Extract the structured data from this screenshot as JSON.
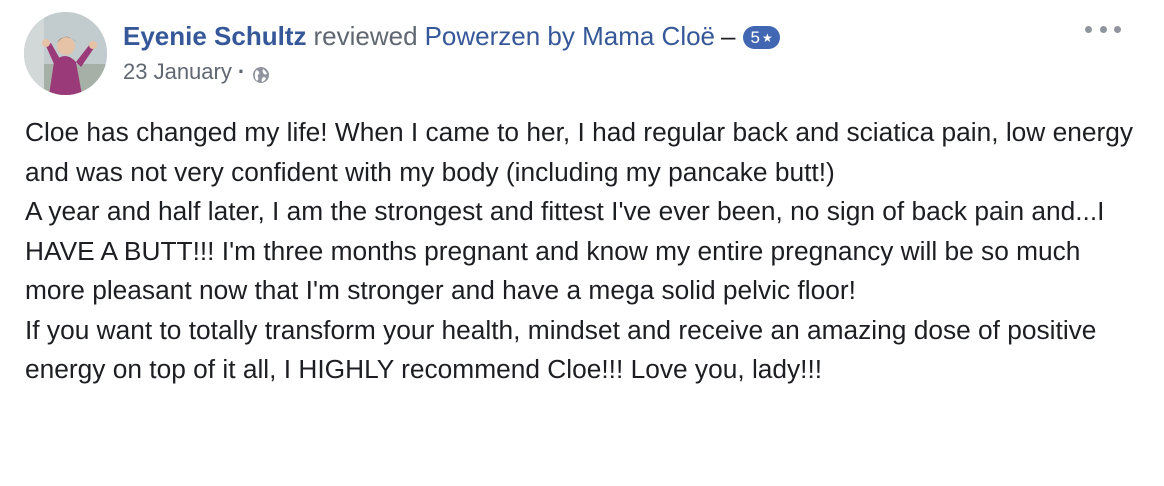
{
  "post": {
    "author": "Eyenie Schultz",
    "action": "reviewed",
    "page_name": "Powerzen by Mama Cloë",
    "separator": "–",
    "rating": {
      "value": "5",
      "icon": "star-icon",
      "glyph": "★"
    },
    "date": "23 January",
    "dot": "·",
    "privacy_icon": "globe-icon",
    "options_icon": "more-options-icon",
    "body": [
      "Cloe has changed my life! When I came to her, I had regular back and sciatica pain, low energy and was not very confident with my body (including my pancake butt!)",
      "A year and half later, I am the strongest and fittest I've ever been, no sign of back pain and...I HAVE A BUTT!!! I'm three months pregnant and know my entire pregnancy will be so much more pleasant now that I'm stronger and have a mega solid pelvic floor!",
      "If you want to totally transform your health, mindset and receive an amazing dose of positive energy on top of it all, I HIGHLY recommend Cloe!!! Love you, lady!!!"
    ]
  },
  "colors": {
    "link": "#365899",
    "secondary_text": "#606770",
    "body_text": "#1c1e21",
    "badge": "#4267b2",
    "icon_gray": "#90949c"
  }
}
